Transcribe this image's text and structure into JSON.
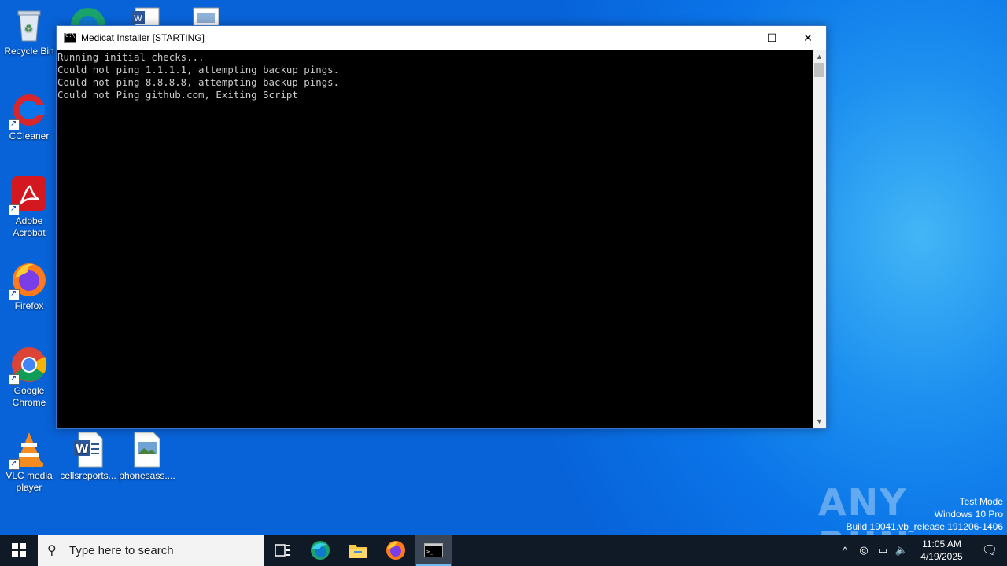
{
  "desktop": {
    "icons": [
      {
        "label": "Recycle Bin",
        "icon": "recycle-bin-icon",
        "shortcut": false
      },
      {
        "label": "CCleaner",
        "icon": "ccleaner-icon",
        "shortcut": true
      },
      {
        "label": "Adobe Acrobat",
        "icon": "adobe-acrobat-icon",
        "shortcut": true
      },
      {
        "label": "Firefox",
        "icon": "firefox-icon",
        "shortcut": true
      },
      {
        "label": "Google Chrome",
        "icon": "chrome-icon",
        "shortcut": true
      },
      {
        "label": "VLC media player",
        "icon": "vlc-icon",
        "shortcut": true
      },
      {
        "label": "cellsreports...",
        "icon": "word-document-icon",
        "shortcut": false
      },
      {
        "label": "phonesass....",
        "icon": "image-file-icon",
        "shortcut": false
      }
    ]
  },
  "window": {
    "title": "Medicat Installer [STARTING]",
    "minimize_glyph": "—",
    "maximize_glyph": "☐",
    "close_glyph": "✕",
    "console_lines": [
      "Running initial checks...",
      "Could not ping 1.1.1.1, attempting backup pings.",
      "Could not ping 8.8.8.8, attempting backup pings.",
      "Could not Ping github.com, Exiting Script"
    ]
  },
  "watermark": {
    "brand": "ANY RUN",
    "line1": "Test Mode",
    "line2": "Windows 10 Pro",
    "line3": "Build 19041.vb_release.191206-1406"
  },
  "taskbar": {
    "search_placeholder": "Type here to search",
    "time": "11:05 AM",
    "date": "4/19/2025"
  },
  "colors": {
    "desktop_blue": "#0a74e8",
    "taskbar": "#101a26",
    "console_bg": "#000000",
    "console_text": "#cccccc"
  }
}
